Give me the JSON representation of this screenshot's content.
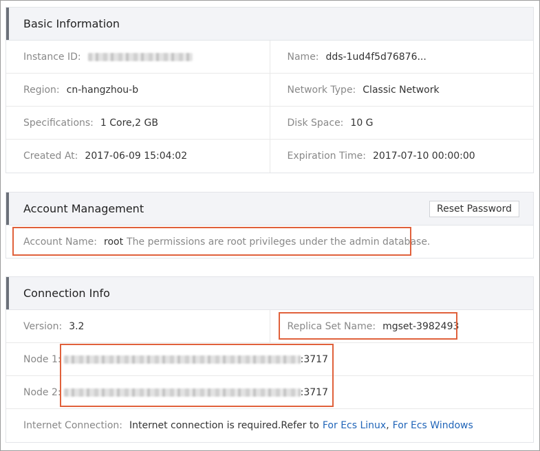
{
  "basic": {
    "title": "Basic Information",
    "instance_id_label": "Instance ID:",
    "name_label": "Name:",
    "name_value": "dds-1ud4f5d76876...",
    "region_label": "Region:",
    "region_value": "cn-hangzhou-b",
    "network_label": "Network Type:",
    "network_value": "Classic Network",
    "spec_label": "Specifications:",
    "spec_value": "1 Core,2 GB",
    "disk_label": "Disk Space:",
    "disk_value": "10 G",
    "created_label": "Created At:",
    "created_value": "2017-06-09 15:04:02",
    "expiration_label": "Expiration Time:",
    "expiration_value": "2017-07-10 00:00:00"
  },
  "account": {
    "title": "Account Management",
    "reset_button": "Reset Password",
    "name_label": "Account Name:",
    "name_value": "root",
    "note": "The permissions are root privileges under the admin database."
  },
  "connection": {
    "title": "Connection Info",
    "version_label": "Version:",
    "version_value": "3.2",
    "replica_label": "Replica Set Name:",
    "replica_value": "mgset-3982493",
    "node1_label": "Node 1:",
    "node1_port": ":3717",
    "node2_label": "Node 2:",
    "node2_port": ":3717",
    "internet_label": "Internet Connection:",
    "internet_text": "Internet connection is required.Refer to",
    "link_linux": "For Ecs Linux",
    "link_sep": ",",
    "link_windows": "For Ecs Windows"
  },
  "colors": {
    "highlight": "#e0603a",
    "link": "#1f64b8",
    "header_bg": "#f3f4f7"
  }
}
